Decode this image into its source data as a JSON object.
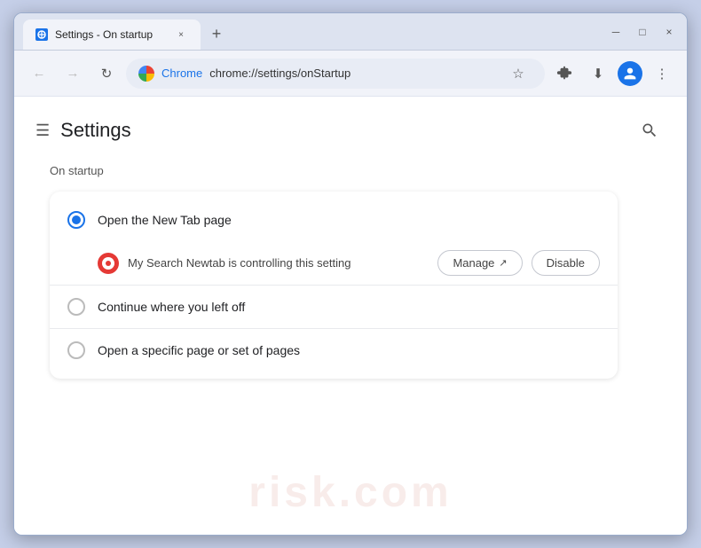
{
  "window": {
    "title": "Settings - On startup",
    "favicon_label": "S",
    "tab_close": "×",
    "new_tab": "+",
    "ctrl_minimize": "─",
    "ctrl_maximize": "□",
    "ctrl_close": "×"
  },
  "nav": {
    "back_icon": "←",
    "forward_icon": "→",
    "reload_icon": "↻",
    "chrome_label": "Chrome",
    "url": "chrome://settings/onStartup",
    "star_icon": "☆",
    "download_icon": "⬇",
    "profile_icon": "👤",
    "more_icon": "⋮"
  },
  "settings": {
    "hamburger": "☰",
    "title": "Settings",
    "search_icon": "🔍"
  },
  "on_startup": {
    "section_title": "On startup",
    "options": [
      {
        "id": "new-tab",
        "label": "Open the New Tab page",
        "selected": true
      },
      {
        "id": "continue",
        "label": "Continue where you left off",
        "selected": false
      },
      {
        "id": "specific-page",
        "label": "Open a specific page or set of pages",
        "selected": false
      }
    ],
    "extension": {
      "label": "My Search Newtab is controlling this setting",
      "manage_label": "Manage",
      "manage_icon": "↗",
      "disable_label": "Disable"
    }
  },
  "watermark": {
    "text": "risk.com"
  }
}
